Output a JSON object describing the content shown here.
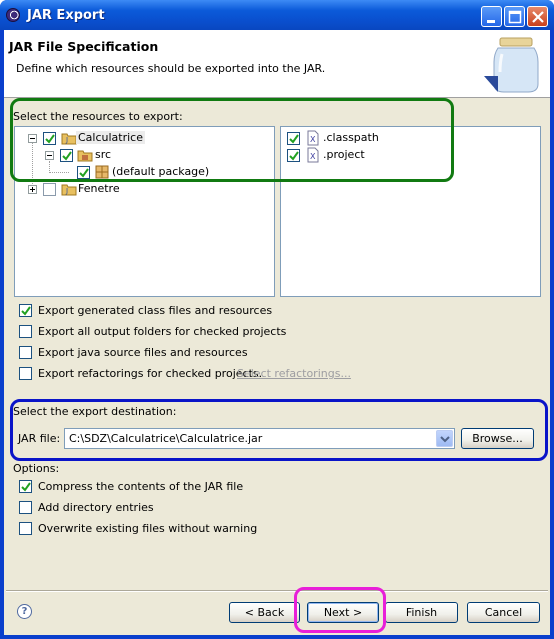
{
  "window": {
    "title": "JAR Export"
  },
  "header": {
    "title": "JAR File Specification",
    "description": "Define which resources should be exported into the JAR."
  },
  "resources": {
    "label": "Select the resources to export:",
    "tree": [
      {
        "label": "Calculatrice",
        "checked": true,
        "expanded": true
      },
      {
        "label": "src",
        "checked": true,
        "expanded": true
      },
      {
        "label": "(default package)",
        "checked": true
      },
      {
        "label": "Fenetre",
        "checked": false,
        "expanded": false
      }
    ],
    "files": [
      {
        "label": ".classpath",
        "checked": true
      },
      {
        "label": ".project",
        "checked": true
      }
    ]
  },
  "export_options": [
    {
      "label": "Export generated class files and resources",
      "checked": true
    },
    {
      "label": "Export all output folders for checked projects",
      "checked": false
    },
    {
      "label": "Export java source files and resources",
      "checked": false
    },
    {
      "label": "Export refactorings for checked projects.",
      "checked": false
    }
  ],
  "select_refactorings_link": "Select refactorings...",
  "destination": {
    "label": "Select the export destination:",
    "jar_file_label": "JAR file:",
    "jar_file_value": "C:\\SDZ\\Calculatrice\\Calculatrice.jar",
    "browse_label": "Browse..."
  },
  "options": {
    "label": "Options:",
    "items": [
      {
        "label": "Compress the contents of the JAR file",
        "checked": true
      },
      {
        "label": "Add directory entries",
        "checked": false
      },
      {
        "label": "Overwrite existing files without warning",
        "checked": false
      }
    ]
  },
  "buttons": {
    "back": "< Back",
    "next": "Next >",
    "finish": "Finish",
    "cancel": "Cancel"
  },
  "help_glyph": "?",
  "highlight_colors": {
    "resources": "#117a11",
    "destination": "#0a14c8",
    "next": "#e81fd8"
  }
}
